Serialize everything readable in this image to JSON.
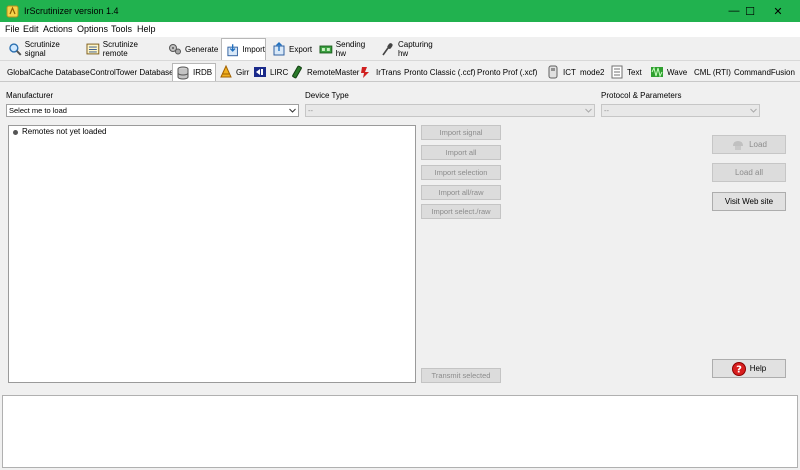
{
  "window": {
    "title": "IrScrutinizer version 1.4",
    "titlebar_color": "#21b24f",
    "controls": {
      "minimize": "—",
      "maximize": "☐",
      "close": "✕"
    }
  },
  "menu": [
    "File",
    "Edit",
    "Actions",
    "Options",
    "Tools",
    "Help"
  ],
  "main_tabs": [
    {
      "label": "Scrutinize signal",
      "icon": "magnifier-icon"
    },
    {
      "label": "Scrutinize remote",
      "icon": "remote-list-icon"
    },
    {
      "label": "Generate",
      "icon": "gears-icon"
    },
    {
      "label": "Import",
      "icon": "import-icon",
      "selected": true
    },
    {
      "label": "Export",
      "icon": "export-icon"
    },
    {
      "label": "Sending hw",
      "icon": "sending-hw-icon"
    },
    {
      "label": "Capturing hw",
      "icon": "microphone-icon"
    }
  ],
  "sub_tabs": [
    {
      "label": "GlobalCache Database"
    },
    {
      "label": "ControlTower Database"
    },
    {
      "label": "IRDB",
      "icon": "database-icon",
      "selected": true
    },
    {
      "label": "Girr",
      "icon": "girr-icon"
    },
    {
      "label": "LIRC",
      "icon": "lirc-icon"
    },
    {
      "label": "RemoteMaster",
      "icon": "remotemaster-icon"
    },
    {
      "label": "IrTrans",
      "icon": "irtrans-icon"
    },
    {
      "label": "Pronto Classic (.ccf)"
    },
    {
      "label": "Pronto Prof (.xcf)"
    },
    {
      "label": "ICT",
      "icon": "ict-icon"
    },
    {
      "label": "mode2"
    },
    {
      "label": "Text",
      "icon": "text-icon"
    },
    {
      "label": "Wave",
      "icon": "wave-icon"
    },
    {
      "label": "CML (RTI)"
    },
    {
      "label": "CommandFusion"
    }
  ],
  "form": {
    "manufacturer_label": "Manufacturer",
    "manufacturer_value": "Select me to load",
    "device_type_label": "Device Type",
    "device_type_value": "--",
    "protocol_label": "Protocol & Parameters",
    "protocol_value": "--"
  },
  "tree": {
    "item": "Remotes not yet loaded"
  },
  "import_buttons": [
    "Import signal",
    "Import all",
    "Import selection",
    "Import all/raw",
    "Import select./raw"
  ],
  "transmit_button": "Transmit selected",
  "right_buttons": {
    "load": "Load",
    "load_all": "Load all",
    "visit": "Visit Web site",
    "help": "Help"
  }
}
